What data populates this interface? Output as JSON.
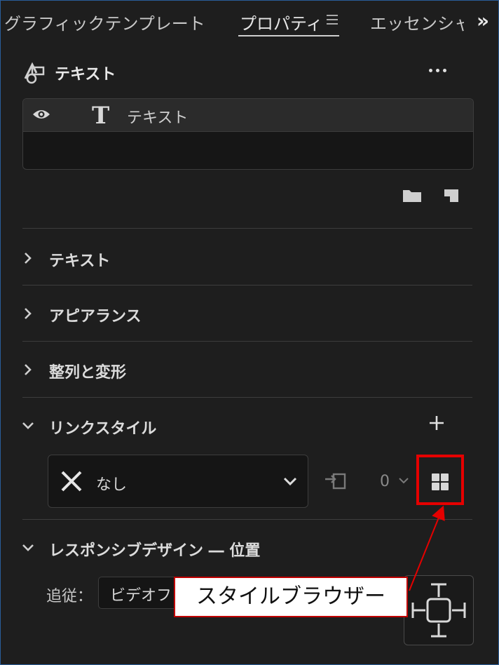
{
  "tabs": [
    {
      "label": "グラフィックテンプレート"
    },
    {
      "label": "プロパティ"
    },
    {
      "label": "エッセンシャ"
    }
  ],
  "header": {
    "title": "テキスト"
  },
  "layer": {
    "label": "テキスト"
  },
  "sections": [
    {
      "title": "テキスト",
      "state": "collapsed"
    },
    {
      "title": "アピアランス",
      "state": "collapsed"
    },
    {
      "title": "整列と変形",
      "state": "collapsed"
    },
    {
      "title": "リンクスタイル",
      "state": "expanded"
    },
    {
      "title": "レスポンシブデザイン ― 位置",
      "state": "expanded"
    }
  ],
  "link_style": {
    "selected": "なし",
    "count": "0"
  },
  "responsive": {
    "follow_label": "追従：",
    "follow_value": "ビデオフ"
  },
  "callout": {
    "text": "スタイルブラウザー"
  },
  "colors": {
    "background": "#1e1e1e",
    "highlight": "#e50000",
    "frame": "#2a5d9a"
  }
}
